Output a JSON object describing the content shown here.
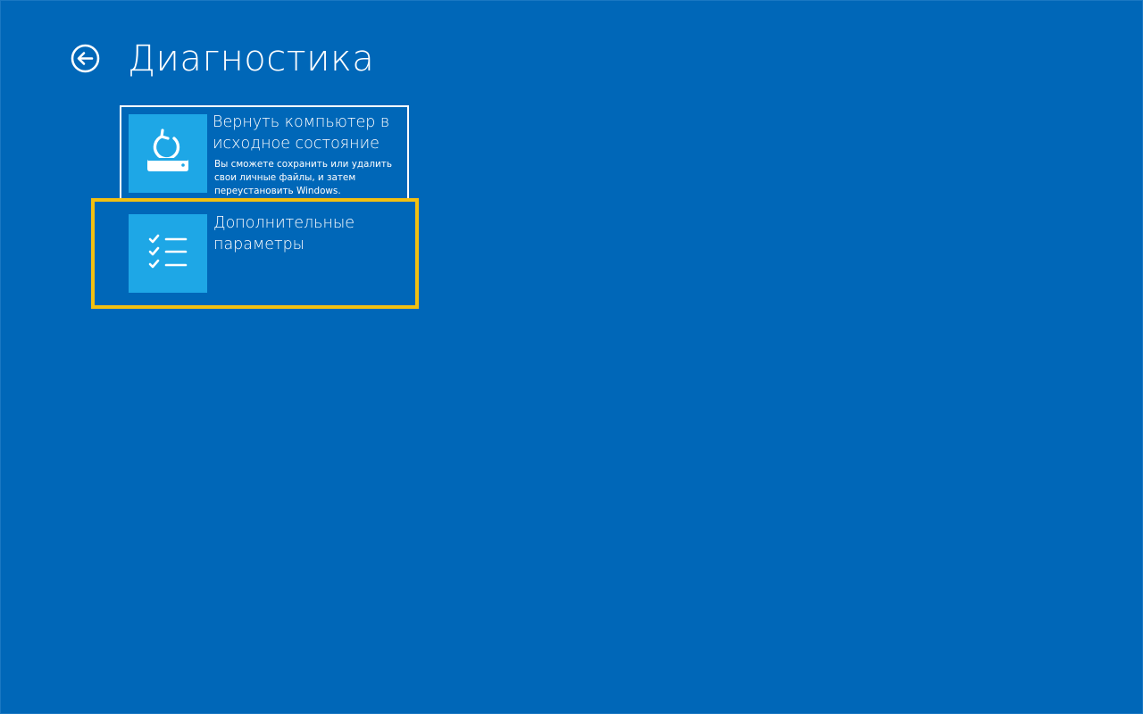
{
  "page": {
    "title": "Диагностика",
    "background_color": "#0067b8",
    "highlight_color": "#f2c011",
    "tile_color": "#1ea7e6"
  },
  "back_button": {
    "icon": "back-arrow-circle-icon"
  },
  "options": [
    {
      "title": "Вернуть компьютер в исходное состояние",
      "description": "Вы сможете сохранить или удалить свои личные файлы, и затем переустановить Windows.",
      "icon": "reset-pc-icon"
    },
    {
      "title": "Дополнительные параметры",
      "icon": "checklist-icon",
      "selected": true
    }
  ]
}
